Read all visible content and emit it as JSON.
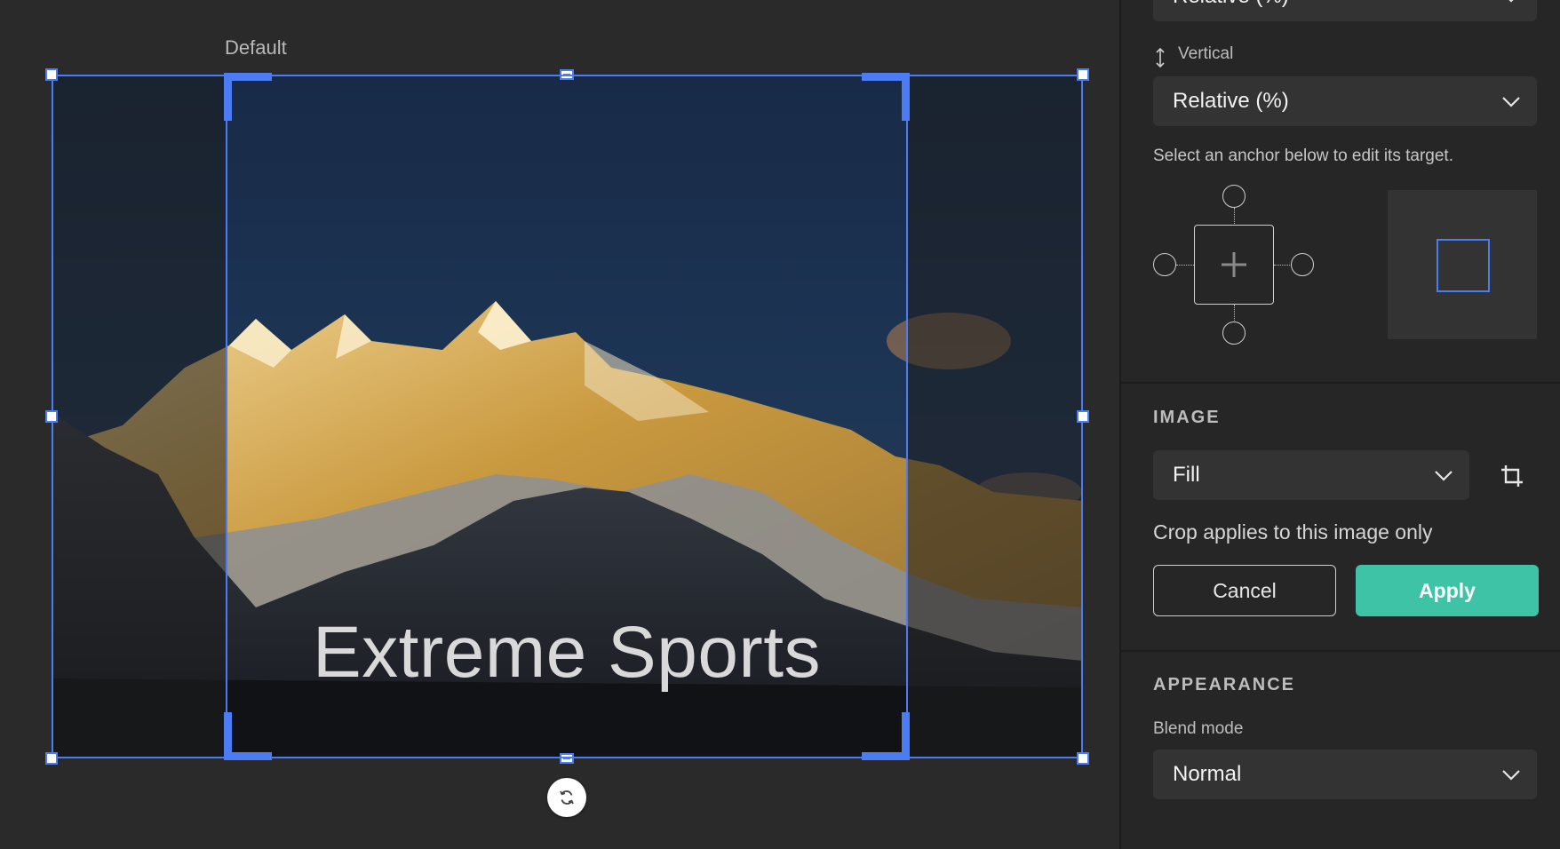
{
  "canvas": {
    "frame_label": "Default",
    "headline": "Extreme Sports",
    "rotate_icon": "rotate-icon"
  },
  "panel": {
    "top_select_value": "Relative (%)",
    "vertical_label": "Vertical",
    "vertical_select_value": "Relative (%)",
    "anchor_hint": "Select an anchor below to edit its target.",
    "image_section_title": "IMAGE",
    "fill_select_value": "Fill",
    "crop_note": "Crop applies to this image only",
    "cancel_label": "Cancel",
    "apply_label": "Apply",
    "appearance_section_title": "APPEARANCE",
    "blend_mode_label": "Blend mode",
    "blend_mode_value": "Normal"
  },
  "colors": {
    "accent": "#4c7cf3",
    "apply": "#3ec3a6",
    "panel_bg": "#262626",
    "canvas_bg": "#2a2a2a"
  }
}
